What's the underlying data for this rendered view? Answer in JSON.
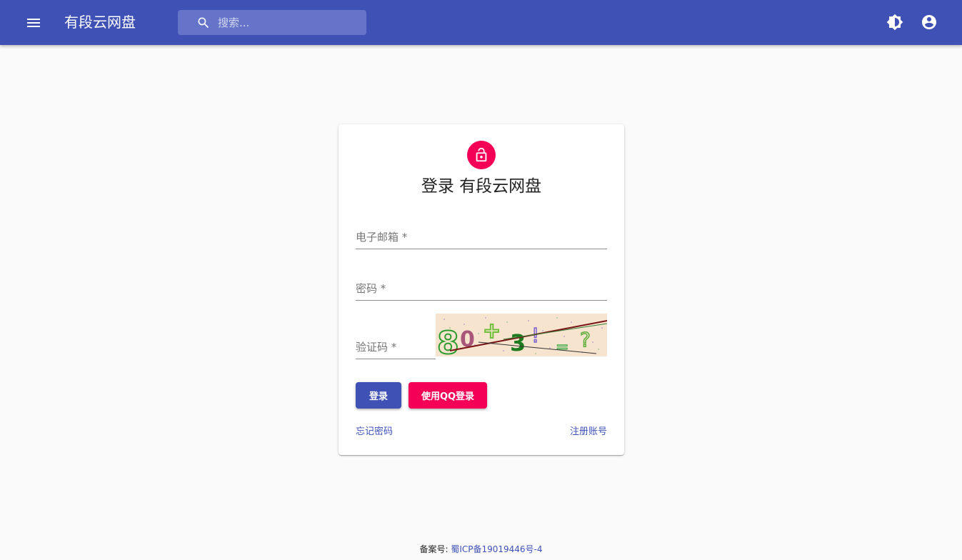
{
  "appbar": {
    "title": "有段云网盘",
    "search_placeholder": "搜索...",
    "icons": [
      "menu-icon",
      "search-icon",
      "brightness-icon",
      "account-circle-icon"
    ]
  },
  "login": {
    "icon": "lock-open-icon",
    "title": "登录 有段云网盘",
    "email_label": "电子邮箱 *",
    "password_label": "密码 *",
    "captcha_label": "验证码 *",
    "captcha_text": "80+3=?",
    "login_button": "登录",
    "qq_login_button": "使用QQ登录",
    "forgot_password": "忘记密码",
    "register": "注册账号"
  },
  "colors": {
    "primary": "#3f51b5",
    "secondary": "#f50057",
    "background": "#fafafa"
  },
  "footer": {
    "label": "备案号: ",
    "icp": "蜀ICP备19019446号-4"
  }
}
